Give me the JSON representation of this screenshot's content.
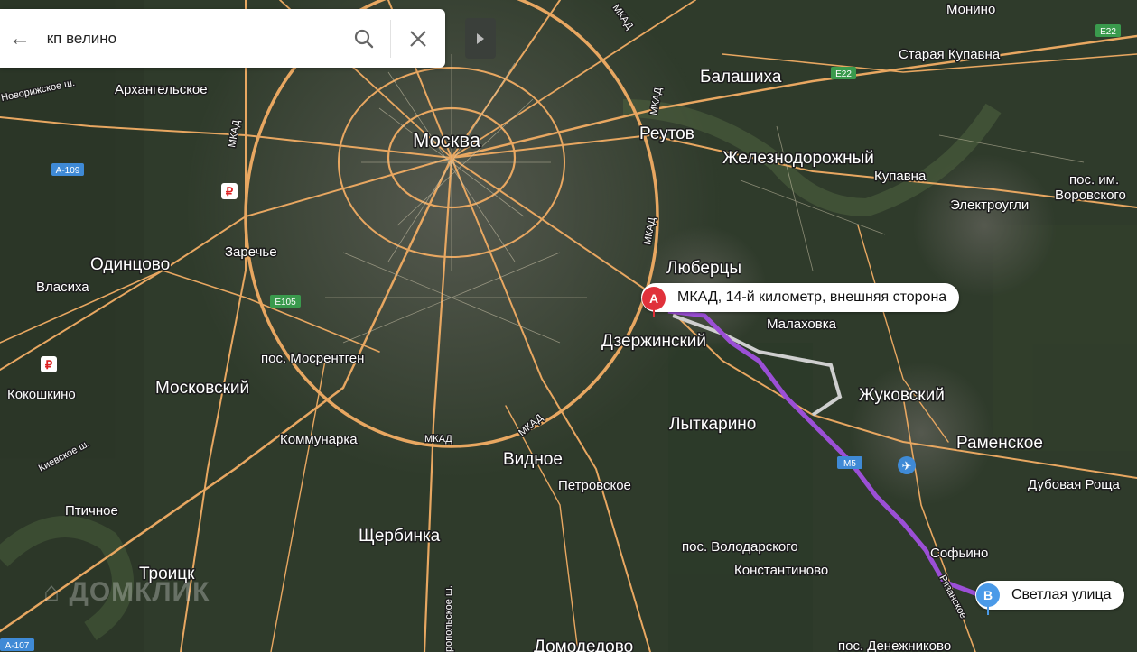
{
  "search": {
    "query": "кп велино"
  },
  "points": {
    "a": {
      "letter": "A",
      "label": "МКАД, 14-й километр, внешняя сторона"
    },
    "b": {
      "letter": "B",
      "label": "Светлая улица"
    }
  },
  "places": [
    {
      "name": "Монино",
      "cls": "town"
    },
    {
      "name": "Старая Купавна",
      "cls": "town"
    },
    {
      "name": "Балашиха",
      "cls": "city"
    },
    {
      "name": "Архангельское",
      "cls": "town"
    },
    {
      "name": "Москва",
      "cls": "capital"
    },
    {
      "name": "Реутов",
      "cls": "city"
    },
    {
      "name": "Железнодорожный",
      "cls": "city"
    },
    {
      "name": "Купавна",
      "cls": "town"
    },
    {
      "name": "пос. им.",
      "cls": "town"
    },
    {
      "name": "Воровского",
      "cls": "town"
    },
    {
      "name": "Электроугли",
      "cls": "town"
    },
    {
      "name": "Заречье",
      "cls": "town"
    },
    {
      "name": "Одинцово",
      "cls": "city"
    },
    {
      "name": "Люберцы",
      "cls": "city"
    },
    {
      "name": "Власиха",
      "cls": "town"
    },
    {
      "name": "Малаховка",
      "cls": "town"
    },
    {
      "name": "Дзержинский",
      "cls": "city"
    },
    {
      "name": "пос. Мосрентген",
      "cls": "town"
    },
    {
      "name": "Кокошкино",
      "cls": "town"
    },
    {
      "name": "Московский",
      "cls": "city"
    },
    {
      "name": "Жуковский",
      "cls": "city"
    },
    {
      "name": "Лыткарино",
      "cls": "city"
    },
    {
      "name": "Коммунарка",
      "cls": "town"
    },
    {
      "name": "Раменское",
      "cls": "city"
    },
    {
      "name": "Видное",
      "cls": "city"
    },
    {
      "name": "Дубовая Роща",
      "cls": "town"
    },
    {
      "name": "Петровское",
      "cls": "town"
    },
    {
      "name": "Птичное",
      "cls": "town"
    },
    {
      "name": "Щербинка",
      "cls": "city"
    },
    {
      "name": "Софьино",
      "cls": "town"
    },
    {
      "name": "пос. Володарского",
      "cls": "town"
    },
    {
      "name": "Троицк",
      "cls": "city"
    },
    {
      "name": "Константиново",
      "cls": "town"
    },
    {
      "name": "пос. Денежниково",
      "cls": "town"
    },
    {
      "name": "Домодедово",
      "cls": "city"
    }
  ],
  "roads": {
    "novorizhskoe": "Новорижское ш.",
    "kievskoe": "Киевское ш.",
    "mkad": "МКАД",
    "a109": "A-109",
    "a107": "A-107",
    "e105": "E105",
    "e22": "E22",
    "m5": "M5",
    "ryazanskoe": "Рязанское",
    "ropolevskoe": "ропольское ш."
  },
  "watermark": "ДОМКЛИК",
  "colors": {
    "route": "#9b4fd6",
    "pin_a": "#e0313b",
    "pin_b": "#4a9ae8",
    "road": "#e8a761"
  }
}
